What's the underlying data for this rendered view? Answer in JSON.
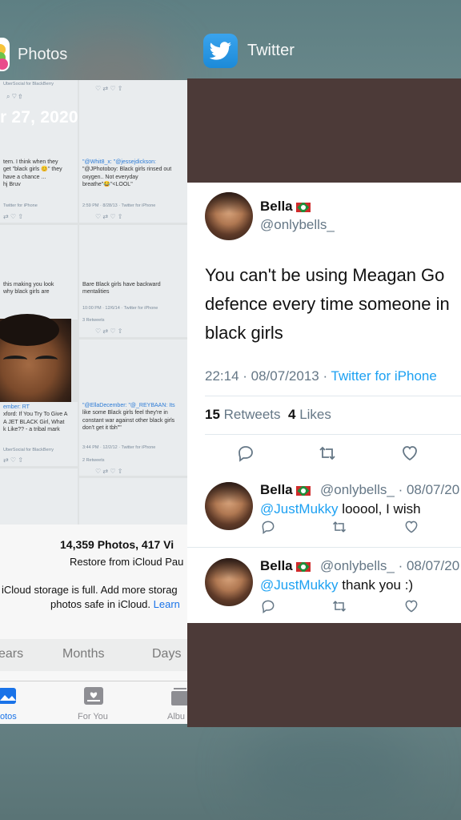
{
  "photos_app": {
    "name": "Photos",
    "date_title": "r 27, 2020",
    "grid_tiles": {
      "t1_header": "UberSocial for BlackBerry",
      "t1_lines": [
        "tern. I think when they",
        "get \"black girls 😊\" they",
        "have a chance ...",
        "hj Bruv"
      ],
      "t1_meta": "Twitter for iPhone",
      "t2_lines": [
        "\"@Whit8_x: \"@jessejdickson:",
        "\"@JPhotoboy: Black girls rinsed out",
        "oxygen.. Not everyday",
        "breathe\"😂\"<LOOL\""
      ],
      "t2_meta": "2:59 PM · 8/28/13 · Twitter for iPhone",
      "t3_lines": [
        "this making you look",
        "why black girls are"
      ],
      "t4_lines": [
        "Bare Black girls have backward",
        "mentalities"
      ],
      "t4_meta": "10:00 PM · 12/6/14 · Twitter for iPhone",
      "t4_retweets": "3 Retweets",
      "t5_lines": [
        "ember: RT",
        "xford: If You Try To Give A",
        "A JET BLACK Girl, What",
        "k Like?? - a tribal mark"
      ],
      "t5_meta": "UberSocial for BlackBerry",
      "t6_lines": [
        "\"@EllaDecember: \"@_REYBAAN: Its",
        "like some Black girls feel they're in",
        "constant war against other black girls",
        "don't get it tbh\"\""
      ],
      "t6_meta": "3:44 PM · 12/2/12 · Twitter for iPhone",
      "t6_retweets": "2 Retweets"
    },
    "count_text": "14,359 Photos, 417 Vi",
    "restore_text": "Restore from iCloud Pau",
    "storage_text_1": "iCloud storage is full. Add more storag",
    "storage_text_2": "photos safe in iCloud.",
    "storage_link": "Learn",
    "segments": [
      "ears",
      "Months",
      "Days"
    ],
    "tabs": [
      "otos",
      "For You",
      "Albu"
    ]
  },
  "twitter_app": {
    "name": "Twitter",
    "tweet": {
      "name": "Bella",
      "handle": "@onlybells_",
      "text_lines": [
        "You can't be using Meagan Go",
        "defence every time someone in",
        "black girls"
      ],
      "time": "22:14 · 08/07/2013 ·",
      "source": "Twitter for iPhone",
      "retweets_count": "15",
      "retweets_label": "Retweets",
      "likes_count": "4",
      "likes_label": "Likes"
    },
    "replies": [
      {
        "name": "Bella",
        "handle_date": "@onlybells_ · 08/07/20",
        "mention": "@JustMukky",
        "text": "looool, I wish"
      },
      {
        "name": "Bella",
        "handle_date": "@onlybells_ · 08/07/20",
        "mention": "@JustMukky",
        "text": "thank you :)"
      }
    ]
  },
  "colors": {
    "twitter_blue": "#1da1f2",
    "ios_link_blue": "#1a73e8",
    "twitter_header_bg": "#4c3a38"
  }
}
